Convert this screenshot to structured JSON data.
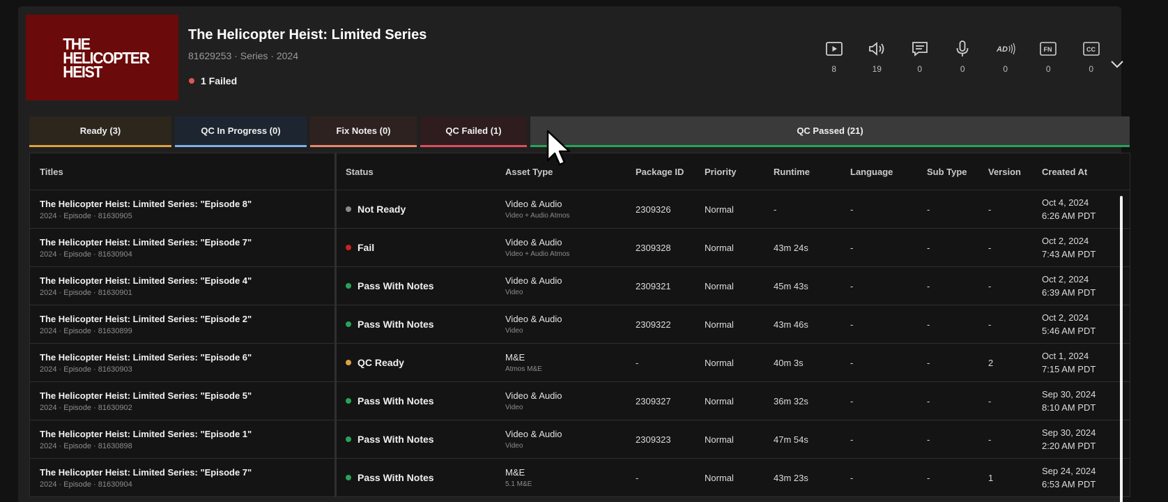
{
  "header": {
    "poster_text": "THE\nHELICOPTER\nHEIST",
    "title": "The Helicopter Heist: Limited Series",
    "meta": "81629253 · Series · 2024",
    "failed_label": "1 Failed",
    "failed_color": "#e05555"
  },
  "stats": [
    {
      "icon": "video-play-icon",
      "value": "8"
    },
    {
      "icon": "audio-speaker-icon",
      "value": "19"
    },
    {
      "icon": "subtitle-message-icon",
      "value": "0"
    },
    {
      "icon": "microphone-icon",
      "value": "0"
    },
    {
      "icon": "audio-description-icon",
      "value": "0"
    },
    {
      "icon": "forced-narrative-icon",
      "value": "0"
    },
    {
      "icon": "closed-caption-icon",
      "value": "0"
    }
  ],
  "tabs": [
    {
      "label": "Ready (3)",
      "color": "#e0a040",
      "bg": "#2c261d"
    },
    {
      "label": "QC In Progress (0)",
      "color": "#7eaee8",
      "bg": "#1d2630"
    },
    {
      "label": "Fix Notes (0)",
      "color": "#e8876a",
      "bg": "#2e2220"
    },
    {
      "label": "QC Failed (1)",
      "color": "#d8505a",
      "bg": "#2e1c1e"
    },
    {
      "label": "QC Passed (21)",
      "color": "#27a556",
      "bg": "#3a3a3a"
    }
  ],
  "columns": {
    "titles": "Titles",
    "status": "Status",
    "asset_type": "Asset Type",
    "package_id": "Package ID",
    "priority": "Priority",
    "runtime": "Runtime",
    "language": "Language",
    "sub_type": "Sub Type",
    "version": "Version",
    "created_at": "Created At"
  },
  "rows": [
    {
      "title": "The Helicopter Heist: Limited Series: \"Episode 8\"",
      "sub": "2024 · Episode · 81630905",
      "status": "Not Ready",
      "status_color": "#8a8a8a",
      "asset": "Video & Audio",
      "asset_sub": "Video + Audio Atmos",
      "package": "2309326",
      "priority": "Normal",
      "runtime": "-",
      "language": "-",
      "subtype": "-",
      "version": "-",
      "date": "Oct 4, 2024",
      "time": "6:26 AM PDT"
    },
    {
      "title": "The Helicopter Heist: Limited Series: \"Episode 7\"",
      "sub": "2024 · Episode · 81630904",
      "status": "Fail",
      "status_color": "#cc2222",
      "asset": "Video & Audio",
      "asset_sub": "Video + Audio Atmos",
      "package": "2309328",
      "priority": "Normal",
      "runtime": "43m 24s",
      "language": "-",
      "subtype": "-",
      "version": "-",
      "date": "Oct 2, 2024",
      "time": "7:43 AM PDT"
    },
    {
      "title": "The Helicopter Heist: Limited Series: \"Episode 4\"",
      "sub": "2024 · Episode · 81630901",
      "status": "Pass With Notes",
      "status_color": "#27a556",
      "asset": "Video & Audio",
      "asset_sub": "Video",
      "package": "2309321",
      "priority": "Normal",
      "runtime": "45m 43s",
      "language": "-",
      "subtype": "-",
      "version": "-",
      "date": "Oct 2, 2024",
      "time": "6:39 AM PDT"
    },
    {
      "title": "The Helicopter Heist: Limited Series: \"Episode 2\"",
      "sub": "2024 · Episode · 81630899",
      "status": "Pass With Notes",
      "status_color": "#27a556",
      "asset": "Video & Audio",
      "asset_sub": "Video",
      "package": "2309322",
      "priority": "Normal",
      "runtime": "43m 46s",
      "language": "-",
      "subtype": "-",
      "version": "-",
      "date": "Oct 2, 2024",
      "time": "5:46 AM PDT"
    },
    {
      "title": "The Helicopter Heist: Limited Series: \"Episode 6\"",
      "sub": "2024 · Episode · 81630903",
      "status": "QC Ready",
      "status_color": "#e0a040",
      "asset": "M&E",
      "asset_sub": "Atmos M&E",
      "package": "-",
      "priority": "Normal",
      "runtime": "40m 3s",
      "language": "-",
      "subtype": "-",
      "version": "2",
      "date": "Oct 1, 2024",
      "time": "7:15 AM PDT"
    },
    {
      "title": "The Helicopter Heist: Limited Series: \"Episode 5\"",
      "sub": "2024 · Episode · 81630902",
      "status": "Pass With Notes",
      "status_color": "#27a556",
      "asset": "Video & Audio",
      "asset_sub": "Video",
      "package": "2309327",
      "priority": "Normal",
      "runtime": "36m 32s",
      "language": "-",
      "subtype": "-",
      "version": "-",
      "date": "Sep 30, 2024",
      "time": "8:10 AM PDT"
    },
    {
      "title": "The Helicopter Heist: Limited Series: \"Episode 1\"",
      "sub": "2024 · Episode · 81630898",
      "status": "Pass With Notes",
      "status_color": "#27a556",
      "asset": "Video & Audio",
      "asset_sub": "Video",
      "package": "2309323",
      "priority": "Normal",
      "runtime": "47m 54s",
      "language": "-",
      "subtype": "-",
      "version": "-",
      "date": "Sep 30, 2024",
      "time": "2:20 AM PDT"
    },
    {
      "title": "The Helicopter Heist: Limited Series: \"Episode 7\"",
      "sub": "2024 · Episode · 81630904",
      "status": "Pass With Notes",
      "status_color": "#27a556",
      "asset": "M&E",
      "asset_sub": "5.1 M&E",
      "package": "-",
      "priority": "Normal",
      "runtime": "43m 23s",
      "language": "-",
      "subtype": "-",
      "version": "1",
      "date": "Sep 24, 2024",
      "time": "6:53 AM PDT"
    }
  ]
}
